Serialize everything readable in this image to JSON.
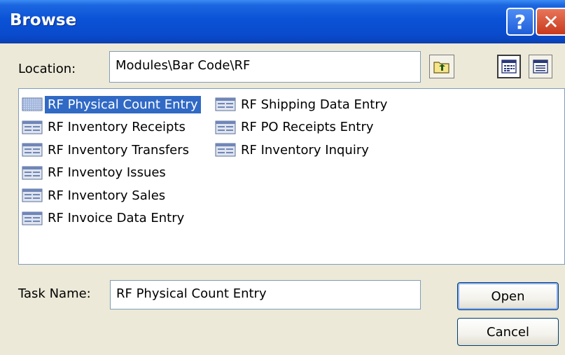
{
  "window": {
    "title": "Browse",
    "help_glyph": "?",
    "close_glyph": "✕"
  },
  "location": {
    "label": "Location:",
    "value": "Modules\\Bar Code\\RF",
    "up_button_icon": "folder-up-icon",
    "list_view_icon": "list-view-icon",
    "details_view_icon": "details-view-icon"
  },
  "tasks": {
    "column1": [
      {
        "label": "RF Physical Count Entry",
        "selected": true
      },
      {
        "label": "RF Inventory Receipts",
        "selected": false
      },
      {
        "label": "RF Inventory Transfers",
        "selected": false
      },
      {
        "label": "RF Inventoy Issues",
        "selected": false
      },
      {
        "label": "RF Inventory Sales",
        "selected": false
      },
      {
        "label": "RF Invoice Data Entry",
        "selected": false
      }
    ],
    "column2": [
      {
        "label": "RF Shipping Data Entry",
        "selected": false
      },
      {
        "label": "RF PO Receipts Entry",
        "selected": false
      },
      {
        "label": "RF Inventory Inquiry",
        "selected": false
      }
    ]
  },
  "task_name": {
    "label": "Task Name:",
    "value": "RF Physical Count Entry"
  },
  "buttons": {
    "open": "Open",
    "cancel": "Cancel"
  },
  "colors": {
    "titlebar": "#0a52d6",
    "selection": "#316ac5",
    "dialog_bg": "#ece9d8"
  }
}
